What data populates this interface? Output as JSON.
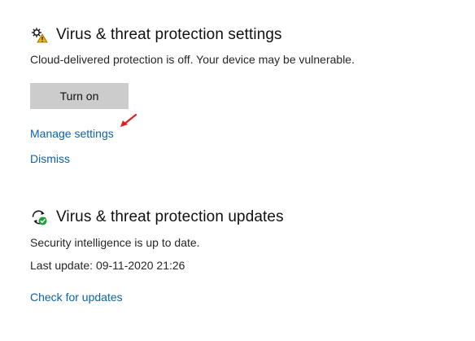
{
  "settings_section": {
    "title": "Virus & threat protection settings",
    "icon": "gear-warning-icon",
    "status_text": "Cloud-delivered protection is off. Your device may be vulnerable.",
    "turn_on_label": "Turn on",
    "manage_settings_label": "Manage settings",
    "dismiss_label": "Dismiss"
  },
  "updates_section": {
    "title": "Virus & threat protection updates",
    "icon": "refresh-check-icon",
    "status_text": "Security intelligence is up to date.",
    "last_update_text": "Last update: 09-11-2020 21:26",
    "check_updates_label": "Check for updates"
  },
  "colors": {
    "link": "#0b63a8",
    "button_bg": "#cccccc",
    "warning": "#f0b400",
    "ok_green": "#1e9e3a",
    "annotation_arrow": "#e02020"
  }
}
